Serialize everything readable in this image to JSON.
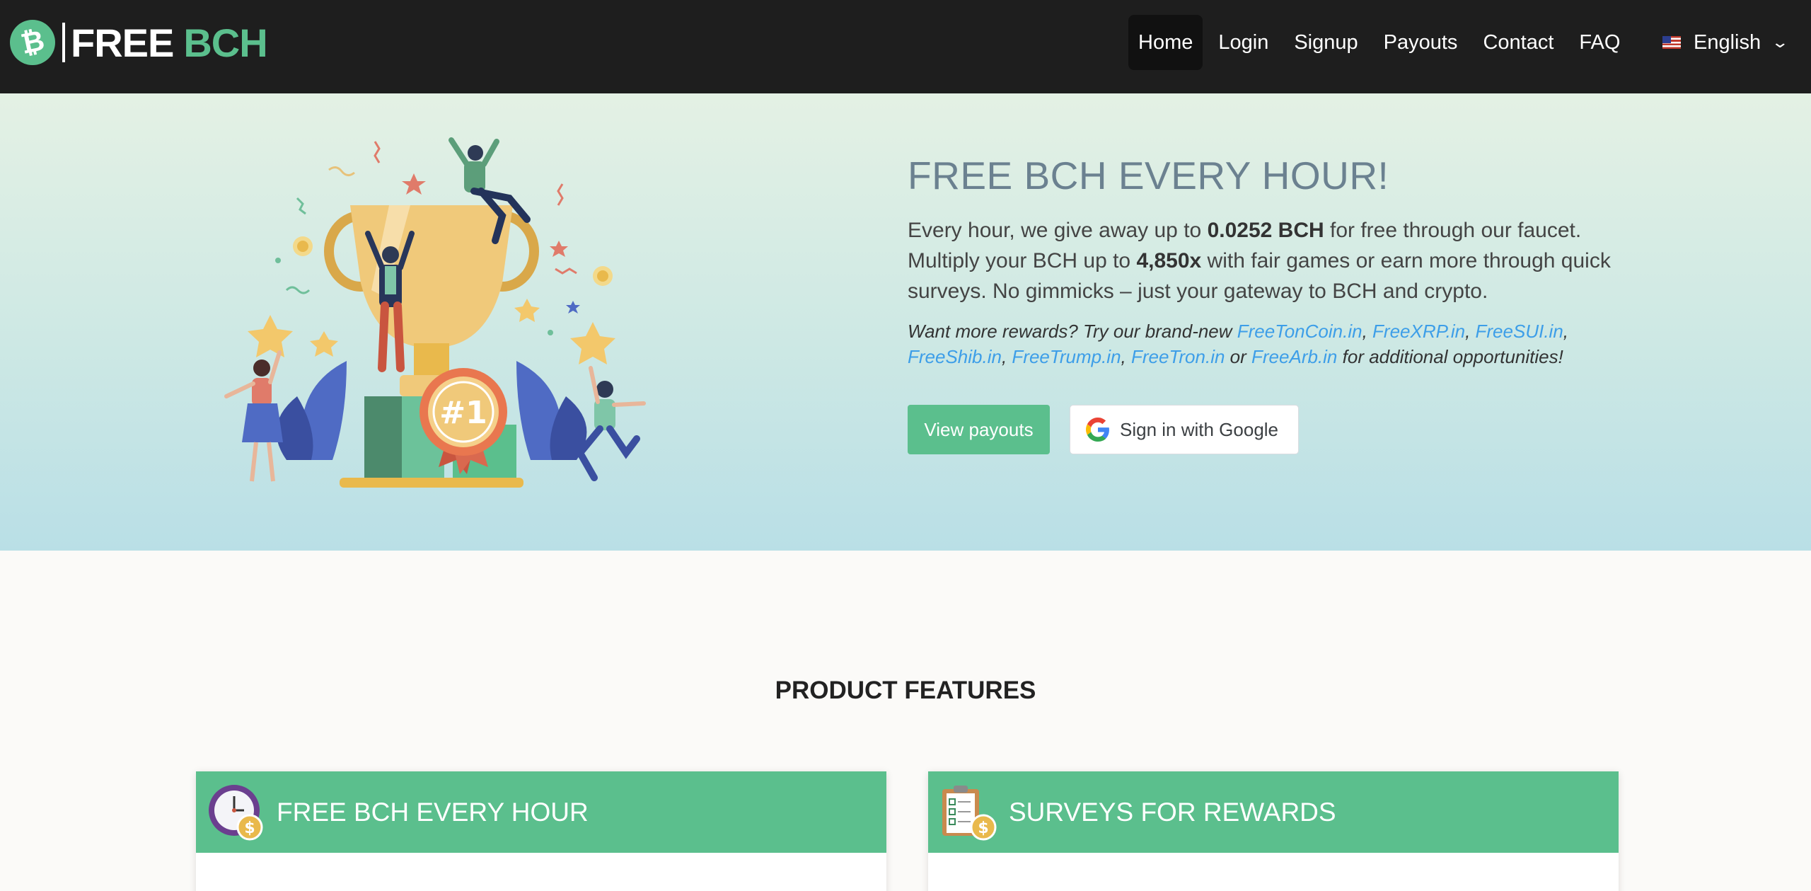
{
  "brand": {
    "coin_symbol": "₿",
    "free": "FREE",
    "bch": "BCH"
  },
  "nav": {
    "items": [
      {
        "label": "Home",
        "active": true
      },
      {
        "label": "Login"
      },
      {
        "label": "Signup"
      },
      {
        "label": "Payouts"
      },
      {
        "label": "Contact"
      },
      {
        "label": "FAQ"
      }
    ],
    "language": {
      "label": "English",
      "flag": "us-flag-icon"
    }
  },
  "hero": {
    "title": "FREE BCH EVERY HOUR!",
    "p_1": "Every hour, we give away up to ",
    "amount": "0.0252 BCH",
    "p_2": " for free through our faucet. Multiply your BCH up to ",
    "multiplier": "4,850x",
    "p_3": " with fair games or earn more through quick surveys. No gimmicks – just your gateway to BCH and crypto.",
    "note_prefix": "Want more rewards? Try our brand-new ",
    "links": [
      "FreeTonCoin.in",
      "FreeXRP.in",
      "FreeSUI.in",
      "FreeShib.in",
      "FreeTrump.in",
      "FreeTron.in",
      "FreeArb.in"
    ],
    "sep_comma": ", ",
    "sep_or": " or ",
    "note_suffix": " for additional opportunities!",
    "btn_payouts": "View payouts",
    "btn_google": "Sign in with Google"
  },
  "features": {
    "title": "PRODUCT FEATURES",
    "cards": [
      {
        "title": "FREE BCH EVERY HOUR",
        "icon": "clock-coin-icon"
      },
      {
        "title": "SURVEYS FOR REWARDS",
        "icon": "clipboard-checklist-icon"
      }
    ]
  },
  "colors": {
    "accent": "#5bbf8d",
    "navbar": "#1e1e1e",
    "link": "#3d9ee8",
    "title": "#6b8190"
  }
}
